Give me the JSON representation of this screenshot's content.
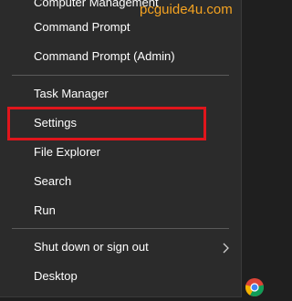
{
  "watermark": "pcguide4u.com",
  "menu": {
    "top_partial": "Computer Management",
    "items": [
      {
        "label": "Command Prompt"
      },
      {
        "label": "Command Prompt (Admin)"
      },
      {
        "label": "Task Manager"
      },
      {
        "label": "Settings",
        "highlighted": true
      },
      {
        "label": "File Explorer"
      },
      {
        "label": "Search"
      },
      {
        "label": "Run"
      },
      {
        "label": "Shut down or sign out",
        "has_submenu": true
      },
      {
        "label": "Desktop"
      }
    ]
  },
  "taskbar": {
    "icon": "chrome-icon"
  },
  "colors": {
    "menu_bg": "#2b2b2b",
    "text": "#ffffff",
    "highlight_border": "#e0151c",
    "watermark": "#f5a321"
  }
}
